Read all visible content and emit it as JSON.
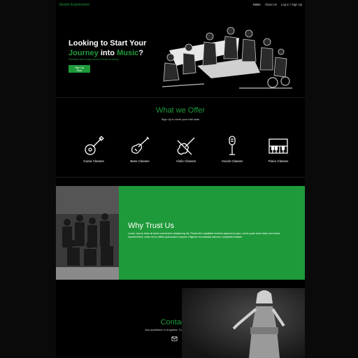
{
  "brand": "Studio Expressive",
  "nav": {
    "items": [
      "Home",
      "About Us",
      "Log In / Sign Up"
    ],
    "active": "Home"
  },
  "hero": {
    "title_line1": "Looking to Start Your",
    "title_word1": "Journey",
    "title_mid": " into ",
    "title_word2": "Music",
    "title_end": "?",
    "subtitle": "Penang's best music school. Prove us wrong.",
    "button": "Sign Up Now"
  },
  "offer": {
    "title": "What we Offer",
    "subtitle": "Sign Up to book your trial slots",
    "classes": [
      {
        "label": "Guitar Classes",
        "icon": "guitar-icon"
      },
      {
        "label": "Bass Classes",
        "icon": "bass-guitar-icon"
      },
      {
        "label": "Violin Classes",
        "icon": "violin-icon"
      },
      {
        "label": "Vocals Classes",
        "icon": "microphone-icon"
      },
      {
        "label": "Piano Classes",
        "icon": "piano-icon"
      }
    ]
  },
  "why": {
    "title": "Why Trust Us",
    "text": "Lorem, ipsum dolor sit amet consectetur adipisicing elit. Reiciendis cupiditate incidunt asperiores quia, omnis quae esse totam nisi soluta reprehenderit, unde rerum officia quibusdam corporis. Eligendi recusandae laborum voluptates beatae!"
  },
  "contact": {
    "title": "Contact Us",
    "subtitle": "Any questions or enquires. Contact us here",
    "socials": [
      "email-icon",
      "whatsapp-icon",
      "facebook-icon"
    ]
  },
  "colors": {
    "accent": "#1f9a3a",
    "background": "#000000",
    "page_bg": "#0a0a0a"
  }
}
